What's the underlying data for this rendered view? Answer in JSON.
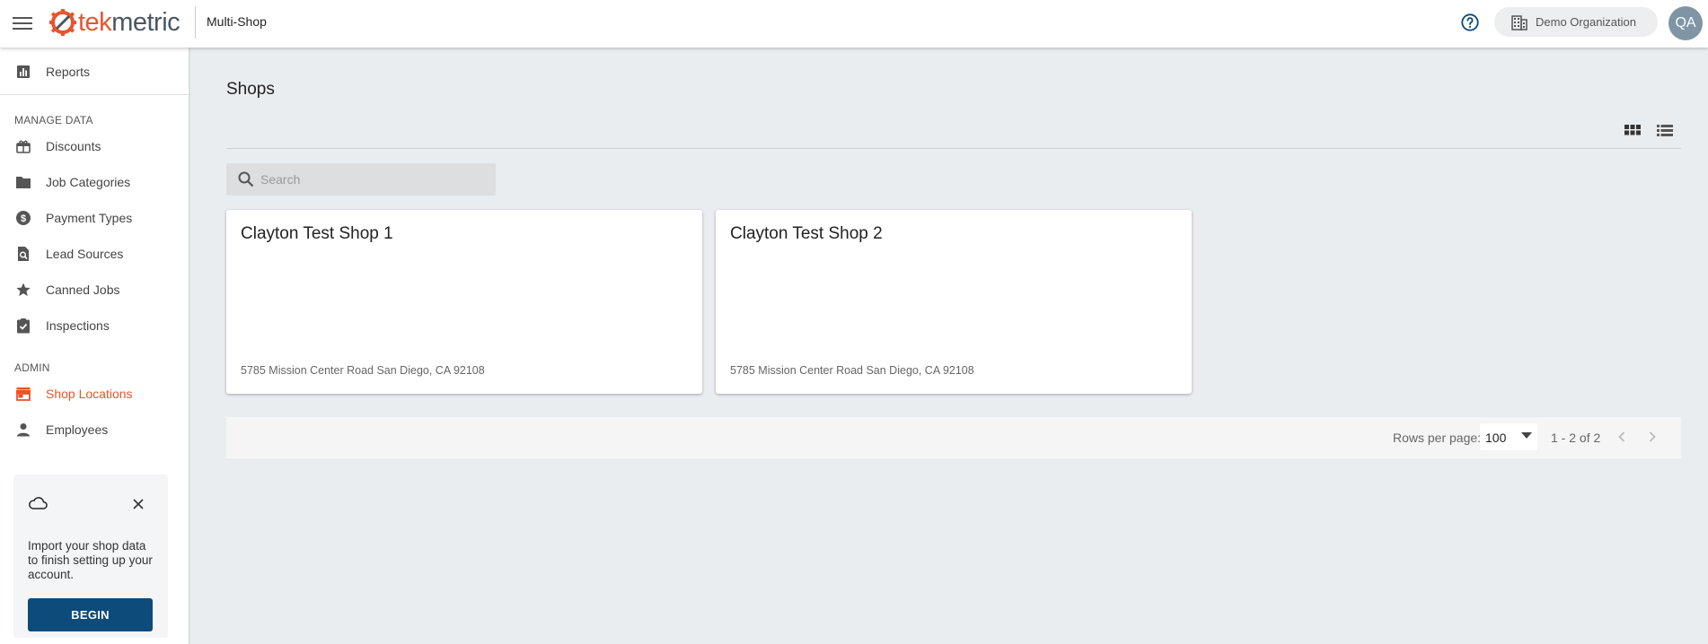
{
  "header": {
    "logo_text_primary": "tek",
    "logo_text_secondary": "metric",
    "app_name": "Multi-Shop",
    "organization": "Demo Organization",
    "avatar_initials": "QA",
    "menu_icon": "hamburger-menu-icon",
    "help_icon": "help-circle-icon",
    "org_icon": "building-icon"
  },
  "sidebar": {
    "top_item": {
      "label": "Reports",
      "icon": "bar-chart-icon"
    },
    "sections": [
      {
        "title": "MANAGE DATA",
        "items": [
          {
            "label": "Discounts",
            "icon": "gift-icon"
          },
          {
            "label": "Job Categories",
            "icon": "folder-icon"
          },
          {
            "label": "Payment Types",
            "icon": "dollar-circle-icon"
          },
          {
            "label": "Lead Sources",
            "icon": "search-document-icon"
          },
          {
            "label": "Canned Jobs",
            "icon": "star-icon"
          },
          {
            "label": "Inspections",
            "icon": "clipboard-check-icon"
          }
        ]
      },
      {
        "title": "ADMIN",
        "items": [
          {
            "label": "Shop Locations",
            "icon": "store-icon",
            "active": true
          },
          {
            "label": "Employees",
            "icon": "person-icon"
          }
        ]
      }
    ],
    "import_card": {
      "message": "Import your shop data to finish setting up your account.",
      "button_label": "BEGIN"
    }
  },
  "main": {
    "title": "Shops",
    "search_placeholder": "Search",
    "shops": [
      {
        "name": "Clayton Test Shop 1",
        "address": "5785 Mission Center Road San Diego, CA 92108"
      },
      {
        "name": "Clayton Test Shop 2",
        "address": "5785 Mission Center Road San Diego, CA 92108"
      }
    ],
    "pagination": {
      "rows_per_page_label": "Rows per page:",
      "rows_per_page_value": "100",
      "range_text": "1 - 2 of 2"
    }
  },
  "colors": {
    "brand_orange": "#e8542d",
    "brand_navy": "#0d4b7a",
    "background": "#eaedf0"
  }
}
